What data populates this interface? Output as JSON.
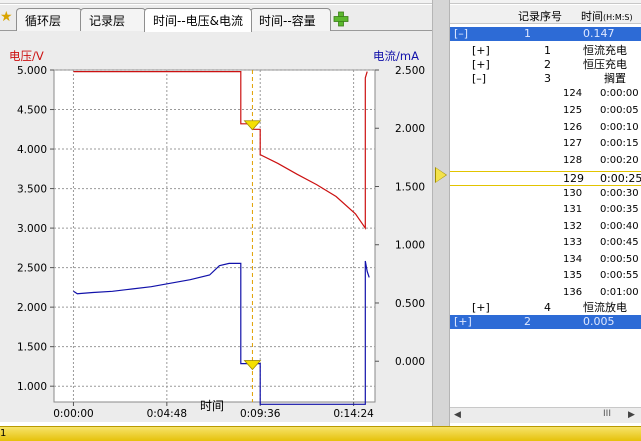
{
  "tabs": [
    {
      "label": "循环层",
      "active": false
    },
    {
      "label": "记录层",
      "active": false
    },
    {
      "label": "时间--电压&电流",
      "active": true
    },
    {
      "label": "时间--容量",
      "active": false
    }
  ],
  "icons": {
    "star": "star-icon",
    "add_tab": "plus-icon"
  },
  "colors": {
    "voltage": "#cc1111",
    "current": "#1111aa",
    "marker": "#f5e000",
    "selection": "#2d6bd6"
  },
  "chart_data": {
    "type": "line",
    "title": "",
    "xlabel": "时间",
    "ylabel_left": "电压/V",
    "ylabel_right": "电流/mA",
    "x_unit": "minutes",
    "xlim": [
      -1,
      15.5
    ],
    "ylim_left": [
      0.8,
      5.0
    ],
    "ylim_right": [
      -0.35,
      2.5
    ],
    "x_ticks": [
      "0:00:00",
      "0:04:48",
      "0:09:36",
      "0:14:24"
    ],
    "x_tick_values": [
      0,
      4.8,
      9.6,
      14.4
    ],
    "y_ticks_left": [
      "5.000",
      "4.500",
      "4.000",
      "3.500",
      "3.000",
      "2.500",
      "2.000",
      "1.500",
      "1.000"
    ],
    "y_tick_values_left": [
      5.0,
      4.5,
      4.0,
      3.5,
      3.0,
      2.5,
      2.0,
      1.5,
      1.0
    ],
    "y_ticks_right": [
      "2.500",
      "2.000",
      "1.500",
      "1.000",
      "0.500",
      "0.000"
    ],
    "y_tick_values_right": [
      2.5,
      2.0,
      1.5,
      1.0,
      0.5,
      0.0
    ],
    "grid": true,
    "cursor_x": 9.2,
    "series": [
      {
        "name": "电压",
        "axis": "left",
        "color": "#cc1111",
        "x": [
          0,
          8.6,
          8.6,
          9.2,
          9.2,
          9.6,
          9.6,
          10.5,
          11.5,
          12.5,
          13.5,
          14.5,
          15.0,
          15.0,
          15.1
        ],
        "y": [
          4.98,
          4.98,
          4.32,
          4.32,
          4.25,
          4.25,
          3.93,
          3.82,
          3.68,
          3.55,
          3.4,
          3.18,
          3.0,
          4.9,
          4.98
        ]
      },
      {
        "name": "电流",
        "axis": "right",
        "color": "#1111aa",
        "x": [
          0,
          0.2,
          1,
          2,
          3,
          4,
          5,
          6,
          7,
          7.5,
          8.0,
          8.6,
          8.6,
          9.6,
          9.6,
          15.0,
          15.0,
          15.1,
          15.2
        ],
        "y": [
          0.6,
          0.58,
          0.59,
          0.6,
          0.62,
          0.64,
          0.67,
          0.7,
          0.74,
          0.82,
          0.84,
          0.84,
          -0.02,
          -0.02,
          -0.37,
          -0.37,
          0.86,
          0.77,
          0.72
        ]
      }
    ]
  },
  "tree": {
    "headers": {
      "seq": "记录序号",
      "time": "时间",
      "time_unit": "(H:M:S)"
    },
    "rows": [
      {
        "toggle": "[–]",
        "num": "1",
        "text": "0.147",
        "style": "sel"
      },
      {
        "toggle": "[+]",
        "num": "1",
        "text": "恒流充电",
        "style": ""
      },
      {
        "toggle": "[+]",
        "num": "2",
        "text": "恒压充电",
        "style": ""
      },
      {
        "toggle": "[–]",
        "num": "3",
        "text": "搁置",
        "style": ""
      },
      {
        "toggle": "",
        "num": "124",
        "text": "0:00:00",
        "style": "small"
      },
      {
        "toggle": "",
        "num": "125",
        "text": "0:00:05",
        "style": "small"
      },
      {
        "toggle": "",
        "num": "126",
        "text": "0:00:10",
        "style": "small"
      },
      {
        "toggle": "",
        "num": "127",
        "text": "0:00:15",
        "style": "small"
      },
      {
        "toggle": "",
        "num": "128",
        "text": "0:00:20",
        "style": "small"
      },
      {
        "toggle": "",
        "num": "129",
        "text": "0:00:25",
        "style": "hl"
      },
      {
        "toggle": "",
        "num": "130",
        "text": "0:00:30",
        "style": "small"
      },
      {
        "toggle": "",
        "num": "131",
        "text": "0:00:35",
        "style": "small"
      },
      {
        "toggle": "",
        "num": "132",
        "text": "0:00:40",
        "style": "small"
      },
      {
        "toggle": "",
        "num": "133",
        "text": "0:00:45",
        "style": "small"
      },
      {
        "toggle": "",
        "num": "134",
        "text": "0:00:50",
        "style": "small"
      },
      {
        "toggle": "",
        "num": "135",
        "text": "0:00:55",
        "style": "small"
      },
      {
        "toggle": "",
        "num": "136",
        "text": "0:01:00",
        "style": "small"
      },
      {
        "toggle": "[+]",
        "num": "4",
        "text": "恒流放电",
        "style": ""
      },
      {
        "toggle": "[+]",
        "num": "2",
        "text": "0.005",
        "style": "sel"
      }
    ],
    "scroll_thumb": "III"
  },
  "statusbar": {
    "text": "1"
  }
}
